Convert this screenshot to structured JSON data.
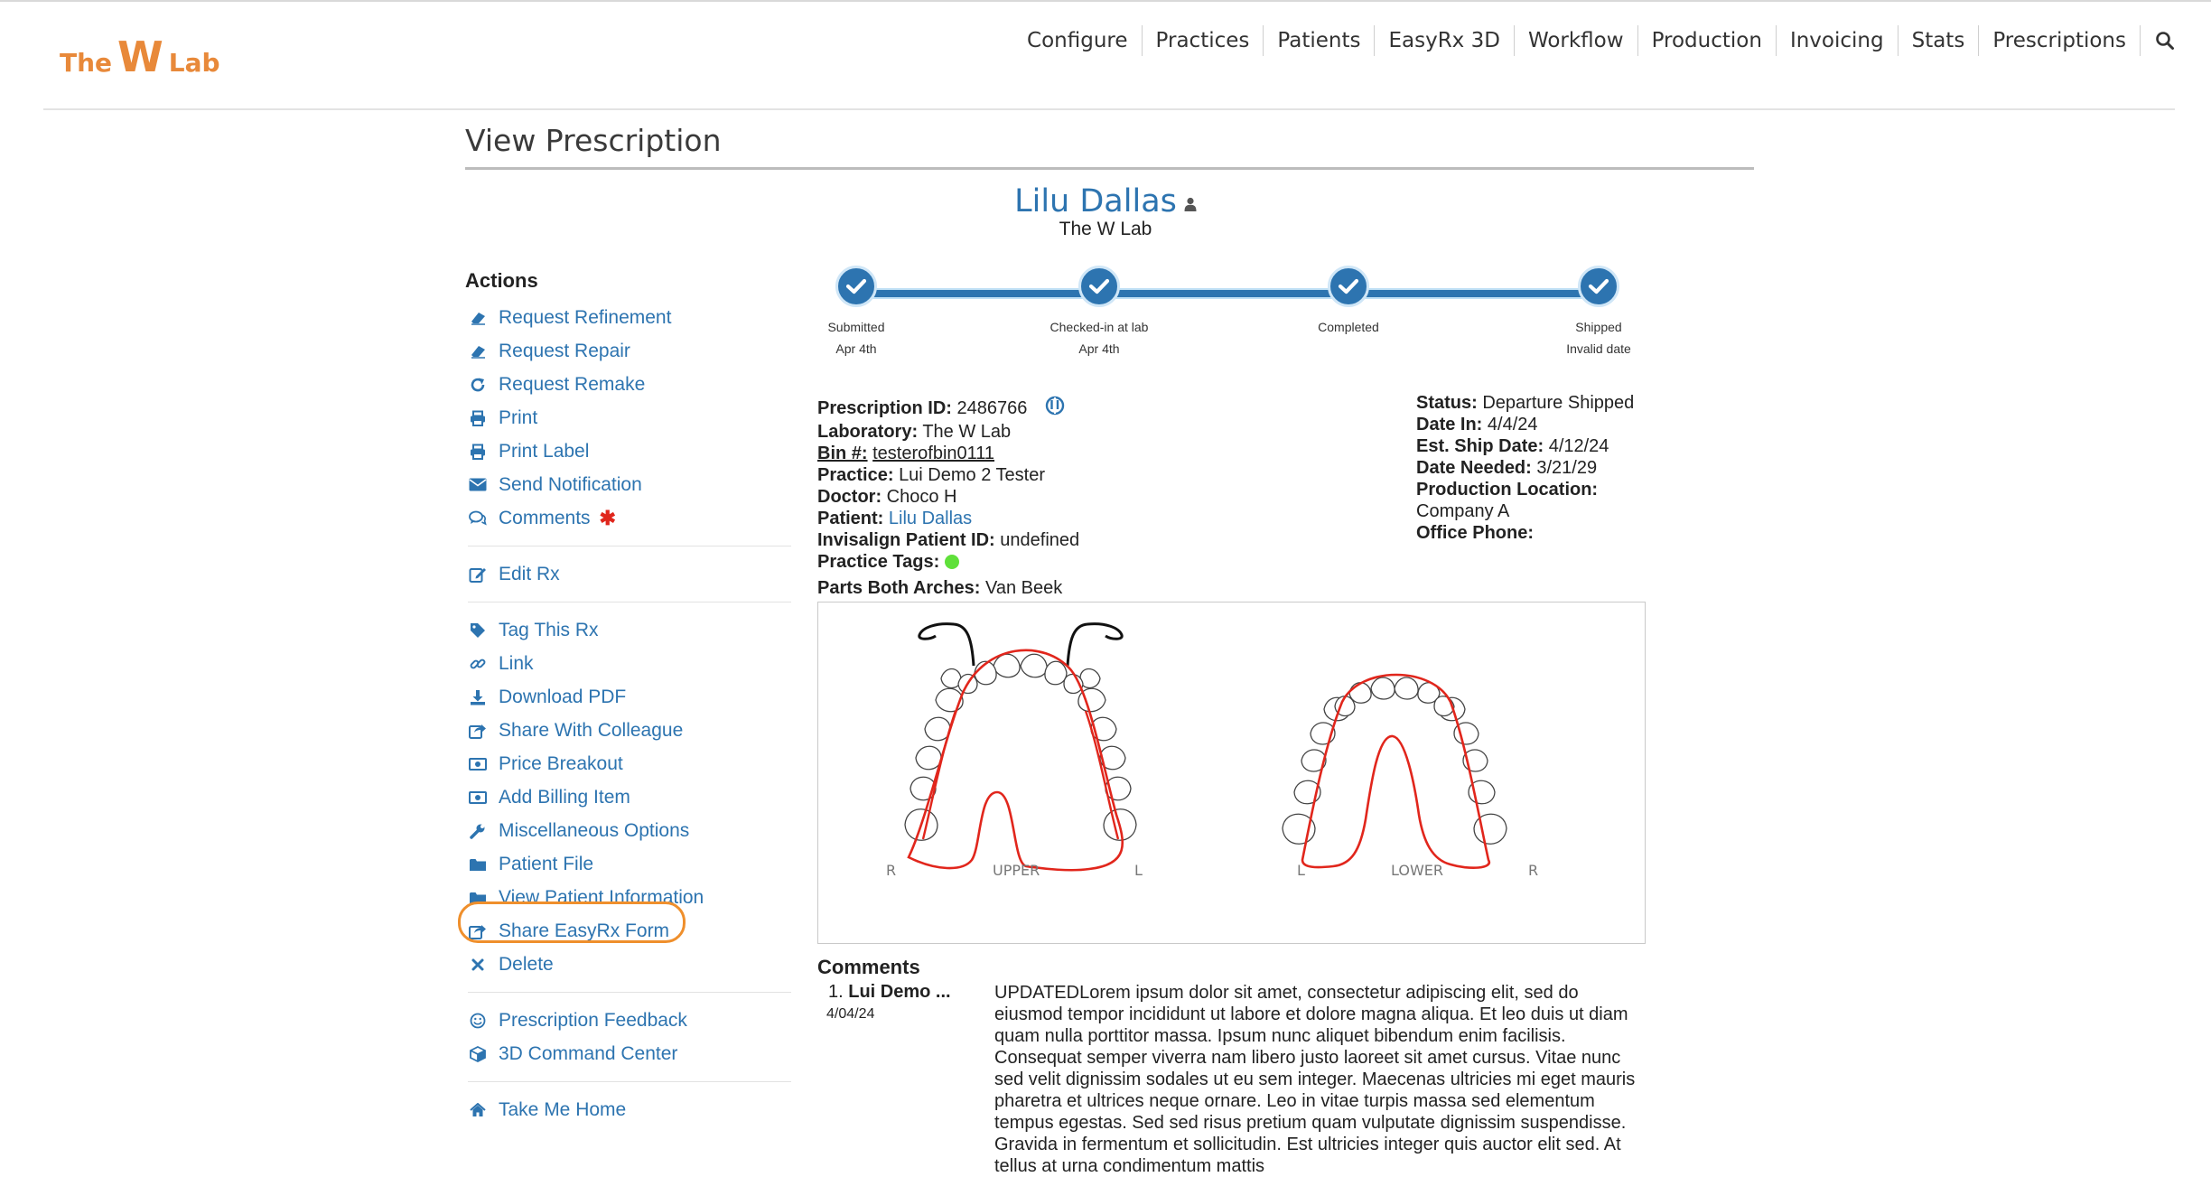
{
  "app": {
    "logo": {
      "left": "The",
      "middle": "W",
      "right": "Lab"
    }
  },
  "nav": {
    "items": [
      "Configure",
      "Practices",
      "Patients",
      "EasyRx 3D",
      "Workflow",
      "Production",
      "Invoicing",
      "Stats",
      "Prescriptions"
    ],
    "search_icon": "search-icon"
  },
  "page": {
    "title": "View Prescription",
    "patient_name": "Lilu Dallas",
    "lab_name": "The W Lab"
  },
  "actions": {
    "title": "Actions",
    "group1": [
      {
        "label": "Request Refinement",
        "icon": "eraser-icon"
      },
      {
        "label": "Request Repair",
        "icon": "eraser-icon"
      },
      {
        "label": "Request Remake",
        "icon": "redo-icon"
      },
      {
        "label": "Print",
        "icon": "print-icon"
      },
      {
        "label": "Print Label",
        "icon": "print-icon"
      },
      {
        "label": "Send Notification",
        "icon": "envelope-icon"
      },
      {
        "label": "Comments",
        "icon": "comments-icon"
      }
    ],
    "group2": [
      {
        "label": "Edit Rx",
        "icon": "edit-icon"
      }
    ],
    "group3": [
      {
        "label": "Tag This Rx",
        "icon": "tag-icon"
      },
      {
        "label": "Link",
        "icon": "link-icon"
      },
      {
        "label": "Download PDF",
        "icon": "download-icon"
      },
      {
        "label": "Share With Colleague",
        "icon": "share-icon"
      },
      {
        "label": "Price Breakout",
        "icon": "money-icon"
      },
      {
        "label": "Add Billing Item",
        "icon": "money-icon"
      },
      {
        "label": "Miscellaneous Options",
        "icon": "wrench-icon"
      },
      {
        "label": "Patient File",
        "icon": "folder-icon"
      },
      {
        "label": "View Patient Information",
        "icon": "folder-icon"
      },
      {
        "label": "Share EasyRx Form",
        "icon": "share-icon"
      },
      {
        "label": "Delete",
        "icon": "times-icon"
      }
    ],
    "group4": [
      {
        "label": "Prescription Feedback",
        "icon": "smile-icon"
      },
      {
        "label": "3D Command Center",
        "icon": "cube-icon"
      }
    ],
    "group5": [
      {
        "label": "Take Me Home",
        "icon": "home-icon"
      }
    ]
  },
  "progress": {
    "steps": [
      {
        "label": "Submitted",
        "date": "Apr 4th"
      },
      {
        "label": "Checked-in at lab",
        "date": "Apr 4th"
      },
      {
        "label": "Completed",
        "date": ""
      },
      {
        "label": "Shipped",
        "date": "Invalid date"
      }
    ]
  },
  "details": {
    "prescription_id_label": "Prescription ID:",
    "prescription_id": "2486766",
    "laboratory_label": "Laboratory:",
    "laboratory": "The W Lab",
    "bin_label": "Bin #:",
    "bin": "testerofbin0111",
    "practice_label": "Practice:",
    "practice": "Lui Demo 2 Tester",
    "doctor_label": "Doctor:",
    "doctor": "Choco H",
    "patient_label": "Patient:",
    "patient": "Lilu Dallas",
    "invisalign_label": "Invisalign Patient ID:",
    "invisalign": "undefined",
    "practice_tags_label": "Practice Tags:",
    "parts_label": "Parts Both Arches:",
    "parts": "Van Beek"
  },
  "status": {
    "status_label": "Status:",
    "status": "Departure Shipped",
    "date_in_label": "Date In:",
    "date_in": "4/4/24",
    "est_ship_label": "Est. Ship Date:",
    "est_ship": "4/12/24",
    "date_needed_label": "Date Needed:",
    "date_needed": "3/21/29",
    "production_location_label": "Production Location:",
    "production_location": "Company A",
    "office_phone_label": "Office Phone:"
  },
  "diagram": {
    "upper_label": "UPPER",
    "lower_label": "LOWER",
    "upper_left": "R",
    "upper_right": "L",
    "lower_left": "L",
    "lower_right": "R"
  },
  "comments": {
    "heading": "Comments",
    "items": [
      {
        "num": "1.",
        "author": "Lui Demo ...",
        "date": "4/04/24",
        "text": "UPDATEDLorem ipsum dolor sit amet, consectetur adipiscing elit, sed do eiusmod tempor incididunt ut labore et dolore magna aliqua. Et leo duis ut diam quam nulla porttitor massa. Ipsum nunc aliquet bibendum enim facilisis. Consequat semper viverra nam libero justo laoreet sit amet cursus. Vitae nunc sed velit dignissim sodales ut eu sem integer. Maecenas ultricies mi eget mauris pharetra et ultrices neque ornare. Leo in vitae turpis massa sed elementum tempus egestas. Sed sed risus pretium quam vulputate dignissim suspendisse. Gravida in fermentum et sollicitudin. Est ultricies integer quis auctor elit sed. At tellus at urna condimentum mattis"
      }
    ]
  },
  "colors": {
    "accent": "#2d74b0",
    "logo": "#e8893a",
    "highlight": "#ef8f2c",
    "tag_dot": "#5fe03a",
    "required": "#e0261c"
  }
}
